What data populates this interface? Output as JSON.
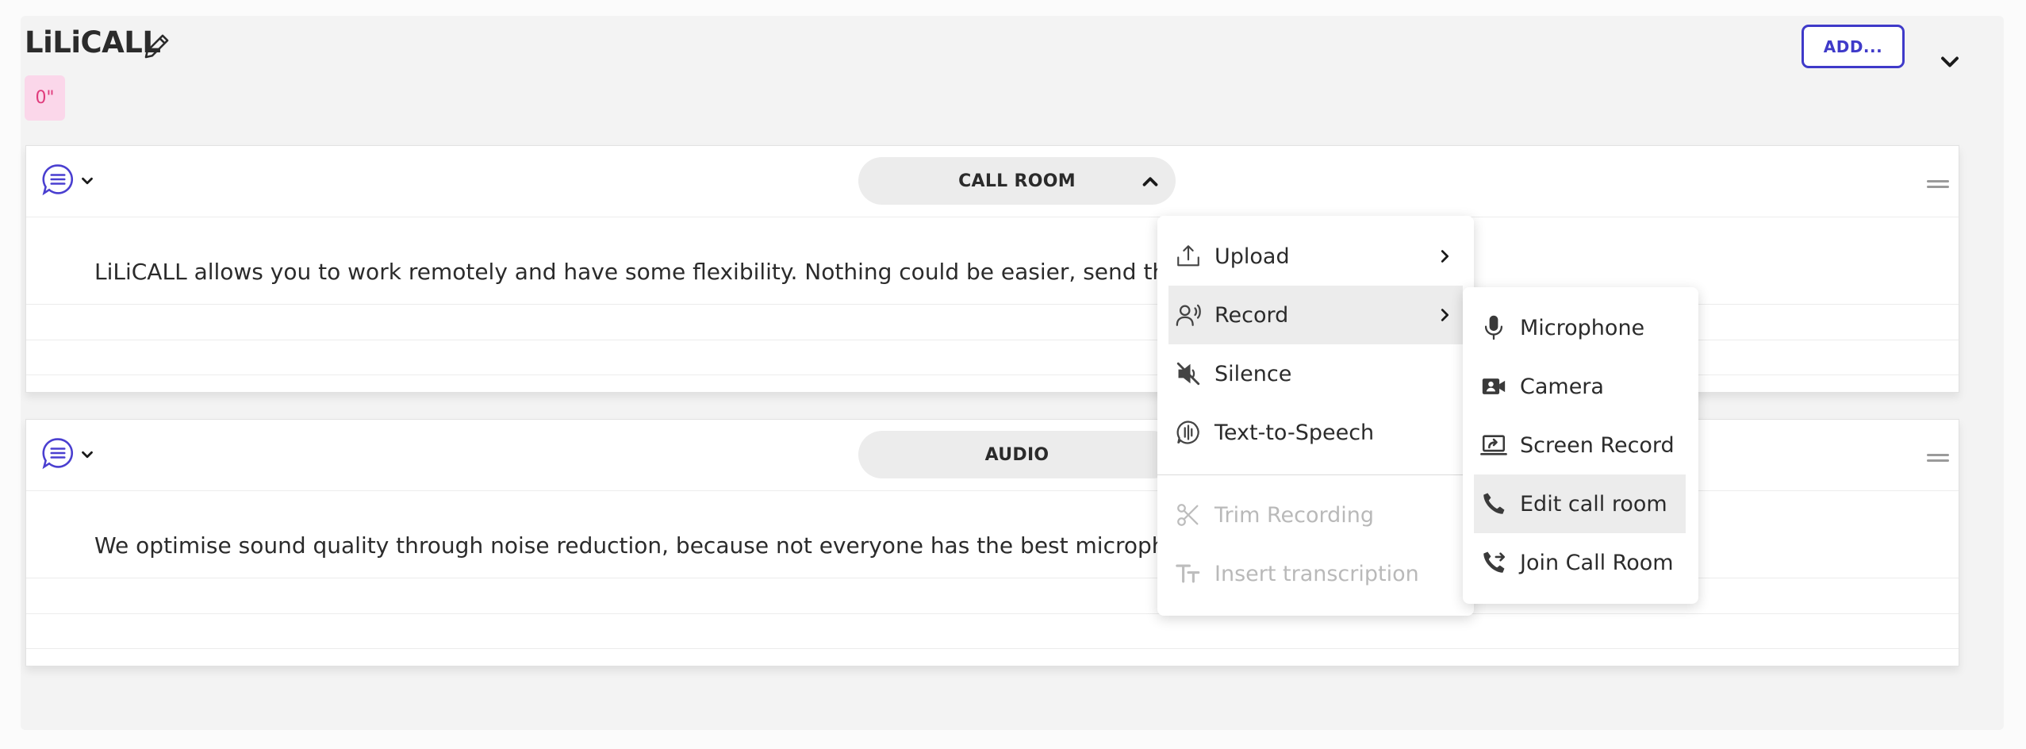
{
  "header": {
    "title": "LiLiCALL",
    "badge": "0\"",
    "add_label": "ADD..."
  },
  "cards": [
    {
      "section_label": "CALL ROOM",
      "text": "LiLiCALL allows you to work remotely and have some flexibility. Nothing could be easier, send the"
    },
    {
      "section_label": "AUDIO",
      "text": "We optimise sound quality through noise reduction, because not everyone has the best microph"
    }
  ],
  "menu": {
    "items": [
      {
        "label": "Upload",
        "icon": "upload-icon",
        "has_submenu": true
      },
      {
        "label": "Record",
        "icon": "record-icon",
        "has_submenu": true,
        "highlighted": true
      },
      {
        "label": "Silence",
        "icon": "mute-icon"
      },
      {
        "label": "Text-to-Speech",
        "icon": "speech-icon"
      },
      {
        "label": "Trim Recording",
        "icon": "scissors-icon",
        "disabled": true
      },
      {
        "label": "Insert transcription",
        "icon": "text-icon",
        "disabled": true
      }
    ]
  },
  "submenu": {
    "items": [
      {
        "label": "Microphone",
        "icon": "microphone-icon"
      },
      {
        "label": "Camera",
        "icon": "camera-icon"
      },
      {
        "label": "Screen Record",
        "icon": "screen-record-icon"
      },
      {
        "label": "Edit call room",
        "icon": "phone-icon",
        "highlighted": true
      },
      {
        "label": "Join Call Room",
        "icon": "phone-forward-icon"
      }
    ]
  },
  "colors": {
    "accent": "#3f3ac9",
    "badge_bg": "#fbd7ea",
    "badge_text": "#e03b7c"
  }
}
